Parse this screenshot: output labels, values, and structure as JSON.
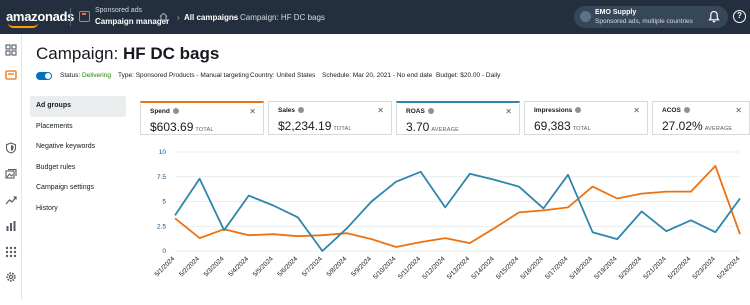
{
  "topbar": {
    "logo_text": "amazonads",
    "product_line1": "Sponsored ads",
    "product_line2": "Campaign manager",
    "breadcrumb_all": "All campaigns",
    "breadcrumb_current": "Campaign: HF DC bags",
    "account_name": "EMO Supply",
    "account_sub": "Sponsored ads, multiple countries"
  },
  "page": {
    "title_prefix": "Campaign:",
    "title_name": "HF DC bags"
  },
  "meta": {
    "status_label": "Status:",
    "status_value": "Delivering",
    "type_label": "Type:",
    "type_value": "Sponsored Products - Manual targeting",
    "country_label": "Country:",
    "country_value": "United States",
    "schedule_label": "Schedule:",
    "schedule_value": "Mar 20, 2021 - No end date",
    "budget_label": "Budget:",
    "budget_value": "$20.00 - Daily"
  },
  "subnav": [
    "Ad groups",
    "Placements",
    "Negative keywords",
    "Budget rules",
    "Campaign settings",
    "History"
  ],
  "metrics": [
    {
      "label": "Spend",
      "value": "$603.69",
      "qualifier": "TOTAL",
      "closable": true
    },
    {
      "label": "Sales",
      "value": "$2,234.19",
      "qualifier": "TOTAL",
      "closable": true
    },
    {
      "label": "ROAS",
      "value": "3.70",
      "qualifier": "AVERAGE",
      "closable": true
    },
    {
      "label": "Impressions",
      "value": "69,383",
      "qualifier": "TOTAL",
      "closable": true
    },
    {
      "label": "ACOS",
      "value": "27.02%",
      "qualifier": "AVERAGE",
      "closable": true
    }
  ],
  "colors": {
    "spend": "#ec7211",
    "roas": "#2e86ab",
    "topbar": "#232f3e"
  },
  "icons": [
    "dashboard-icon",
    "campaign-icon",
    "shield-icon",
    "gallery-icon",
    "trend-icon",
    "reports-icon",
    "apps-icon",
    "settings-icon",
    "bell-icon",
    "help-icon",
    "home-icon"
  ],
  "chart_data": {
    "type": "line",
    "categories": [
      "5/1/2024",
      "5/2/2024",
      "5/3/2024",
      "5/4/2024",
      "5/5/2024",
      "5/6/2024",
      "5/7/2024",
      "5/8/2024",
      "5/9/2024",
      "5/10/2024",
      "5/11/2024",
      "5/12/2024",
      "5/13/2024",
      "5/14/2024",
      "5/15/2024",
      "5/16/2024",
      "5/17/2024",
      "5/18/2024",
      "5/19/2024",
      "5/20/2024",
      "5/21/2024",
      "5/22/2024",
      "5/23/2024",
      "5/24/2024"
    ],
    "y_ticks": [
      "0",
      "2.5",
      "5",
      "7.5",
      "10"
    ],
    "ylim": [
      0,
      10
    ],
    "series": [
      {
        "name": "Spend",
        "color": "#ec7211",
        "values": [
          3.3,
          1.3,
          2.2,
          1.6,
          1.7,
          1.5,
          1.6,
          1.8,
          1.2,
          0.4,
          0.9,
          1.3,
          0.8,
          2.3,
          3.9,
          4.1,
          4.4,
          6.5,
          5.3,
          5.8,
          6.0,
          6.0,
          8.6,
          1.7
        ]
      },
      {
        "name": "ROAS",
        "color": "#2e86ab",
        "values": [
          3.6,
          7.3,
          2.1,
          5.6,
          4.6,
          3.4,
          0.0,
          2.3,
          5.0,
          7.0,
          8.0,
          4.4,
          7.8,
          7.2,
          6.5,
          4.3,
          7.7,
          1.9,
          1.2,
          4.0,
          2.0,
          3.1,
          1.9,
          5.3
        ]
      }
    ],
    "grid": true
  }
}
